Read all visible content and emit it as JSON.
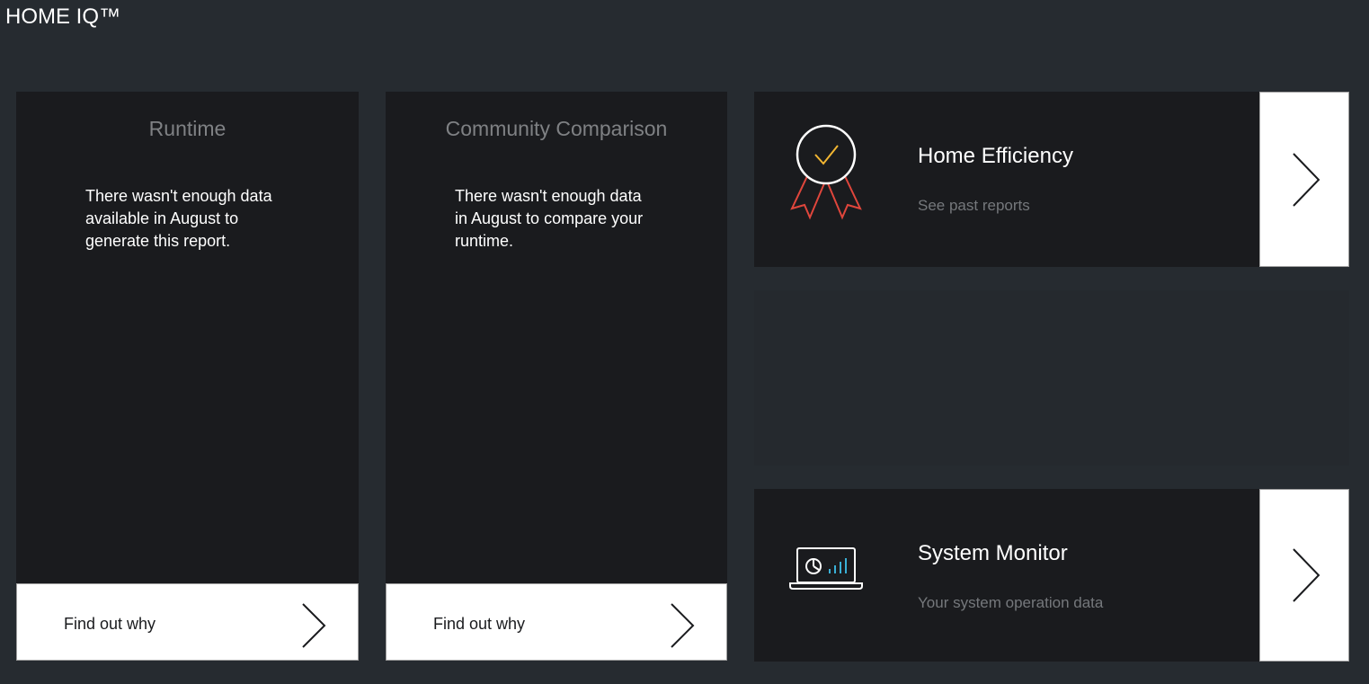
{
  "app": {
    "title": "HOME IQ™"
  },
  "cards": {
    "runtime": {
      "title": "Runtime",
      "message": "There wasn't enough data available in August to generate this report.",
      "footer_label": "Find out why"
    },
    "community": {
      "title": "Community Comparison",
      "message": "There wasn't enough data in August to compare your runtime.",
      "footer_label": "Find out why"
    }
  },
  "tiles": {
    "efficiency": {
      "title": "Home Efficiency",
      "subtitle": "See past reports",
      "icon": "award-ribbon-icon"
    },
    "monitor": {
      "title": "System Monitor",
      "subtitle": "Your system operation data",
      "icon": "laptop-chart-icon"
    }
  },
  "colors": {
    "background": "#262b30",
    "card": "#1a1b1e",
    "muted_text": "#7f8184",
    "award_check": "#f2b632",
    "award_ribbon": "#e0463c",
    "chart_bars": "#3ab0d6"
  }
}
